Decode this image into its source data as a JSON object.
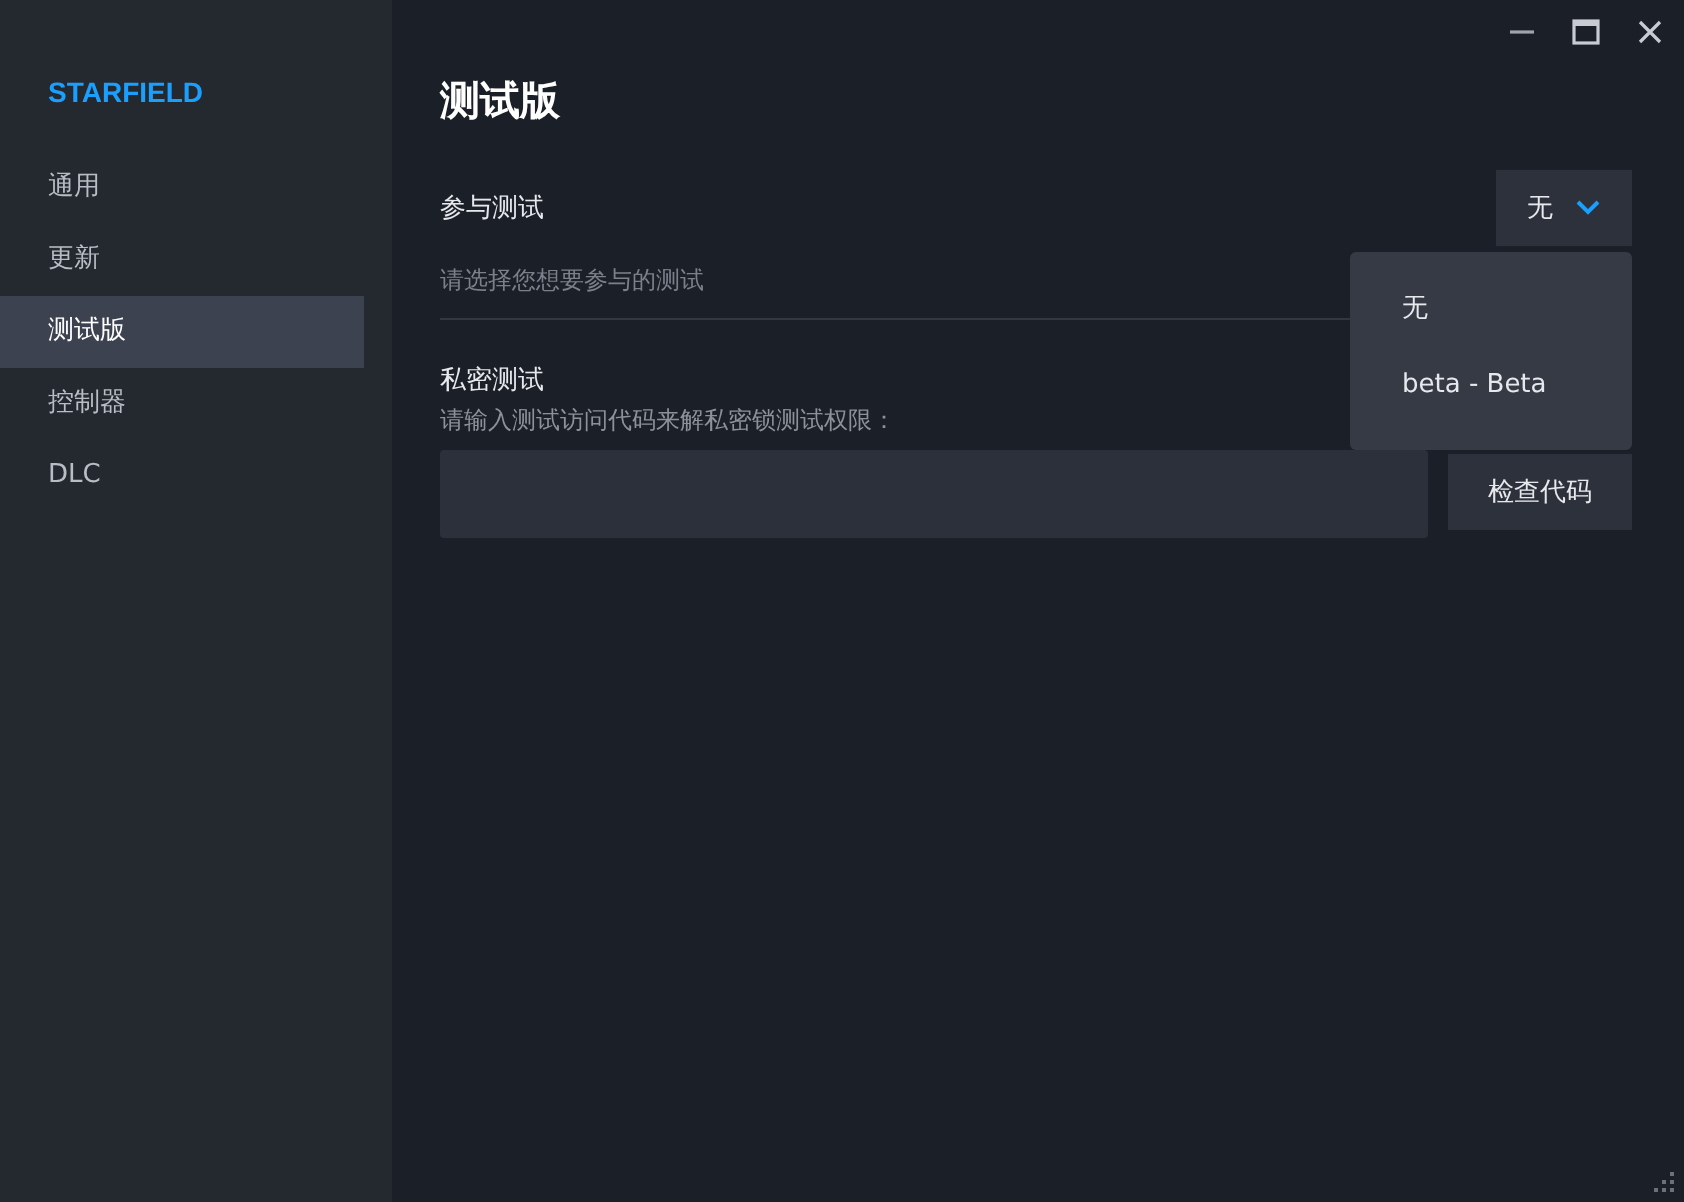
{
  "sidebar": {
    "title": "STARFIELD",
    "items": [
      {
        "label": "通用",
        "selected": false
      },
      {
        "label": "更新",
        "selected": false
      },
      {
        "label": "测试版",
        "selected": true
      },
      {
        "label": "控制器",
        "selected": false
      },
      {
        "label": "DLC",
        "selected": false
      }
    ]
  },
  "page": {
    "title": "测试版",
    "beta": {
      "label": "参与测试",
      "hint": "请选择您想要参与的测试",
      "dropdown": {
        "value": "无",
        "expanded": true,
        "options": [
          {
            "label": "无"
          },
          {
            "label": "beta - Beta"
          }
        ]
      }
    },
    "private": {
      "label": "私密测试",
      "description": "请输入测试访问代码来解私密锁测试权限：",
      "button": "检查代码"
    }
  }
}
